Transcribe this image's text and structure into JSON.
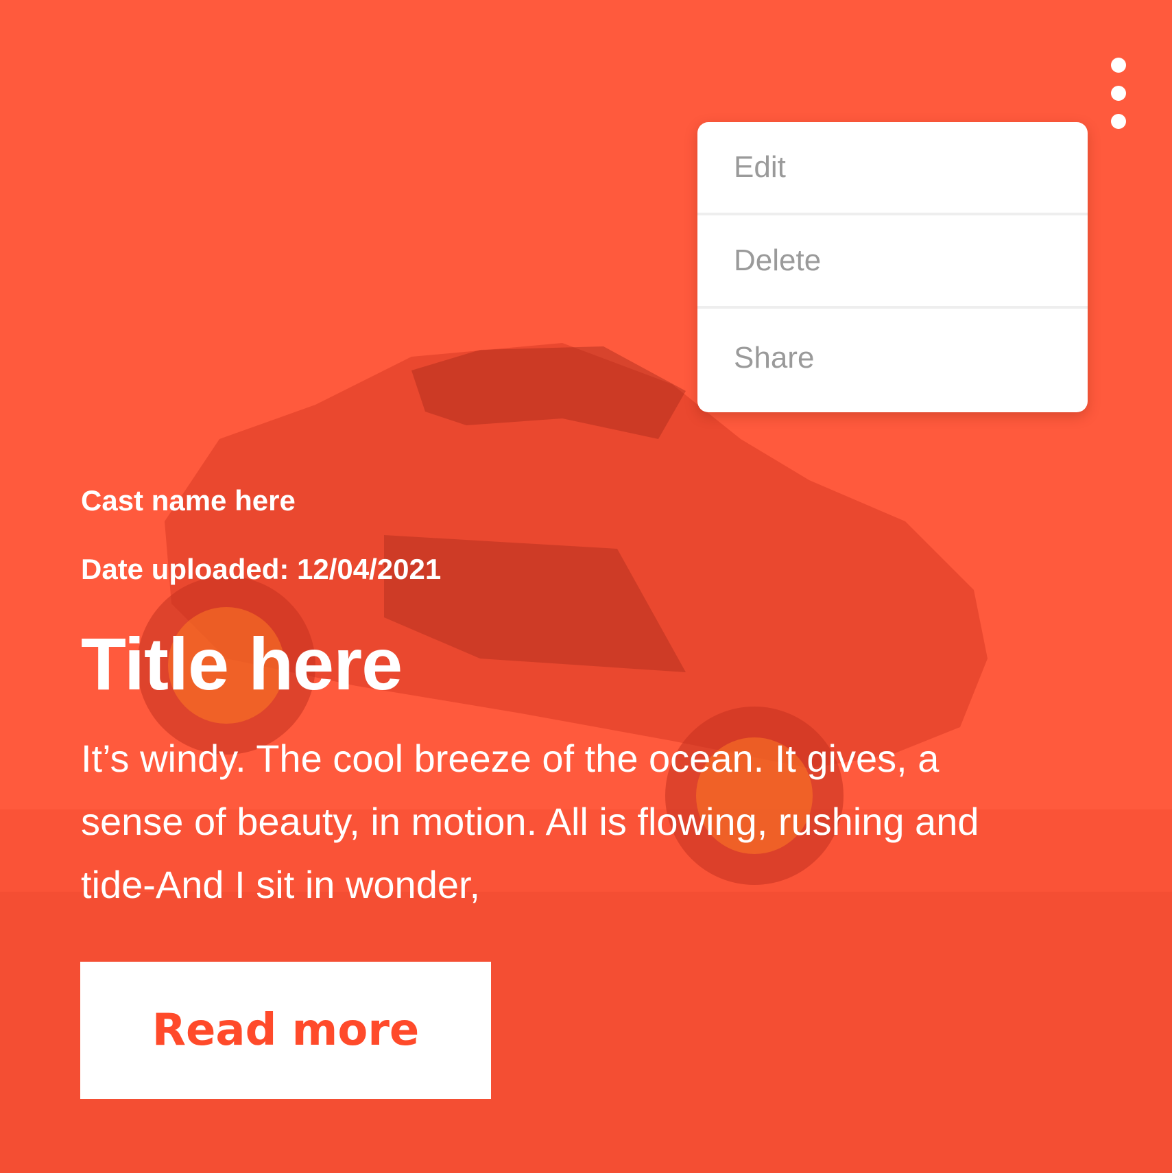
{
  "colors": {
    "background": "#ff5a3d",
    "button_text": "#ff4a2a",
    "menu_text": "#9a9a9a",
    "text": "#ffffff"
  },
  "header": {
    "more_icon": "more-vertical-icon"
  },
  "menu": {
    "items": [
      {
        "label": "Edit"
      },
      {
        "label": "Delete"
      },
      {
        "label": "Share"
      }
    ]
  },
  "post": {
    "cast_name": "Cast name here",
    "date_uploaded": "Date uploaded: 12/04/2021",
    "title": "Title here",
    "excerpt": "It’s windy. The cool breeze of the ocean. It gives, a sense of beauty, in motion. All is flowing, rushing and tide-And I sit in wonder,",
    "read_more_label": "Read more"
  }
}
